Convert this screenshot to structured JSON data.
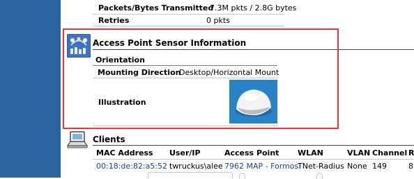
{
  "stats": {
    "transmitted_label": "Packets/Bytes Transmitted",
    "transmitted_value": "7.3M pkts / 2.8G bytes",
    "retries_label": "Retries",
    "retries_value": "0 pkts"
  },
  "sensor": {
    "title": "Access Point Sensor Information",
    "orientation_header": "Orientation",
    "mounting_label": "Mounting Direction",
    "mounting_value": "Desktop/Horizontal Mount",
    "illustration_label": "Illustration"
  },
  "clients": {
    "title": "Clients",
    "columns": [
      "MAC Address",
      "User/IP",
      "Access Point",
      "WLAN",
      "VLAN",
      "Channel",
      "R"
    ],
    "rows": [
      {
        "mac": "00:18:de:82:a5:52",
        "user": "twruckus\\alee",
        "access_point": "7962 MAP - Formos",
        "wlan": "TNet-Radius",
        "vlan": "None",
        "channel": "149",
        "r": "8"
      }
    ]
  },
  "colors": {
    "sidebar": "#2a65a0",
    "highlight": "#e53639",
    "link": "#1c3fa3"
  },
  "icons": {
    "sensor": "access-point-sensor-icon",
    "clients": "clients-laptop-icon"
  }
}
